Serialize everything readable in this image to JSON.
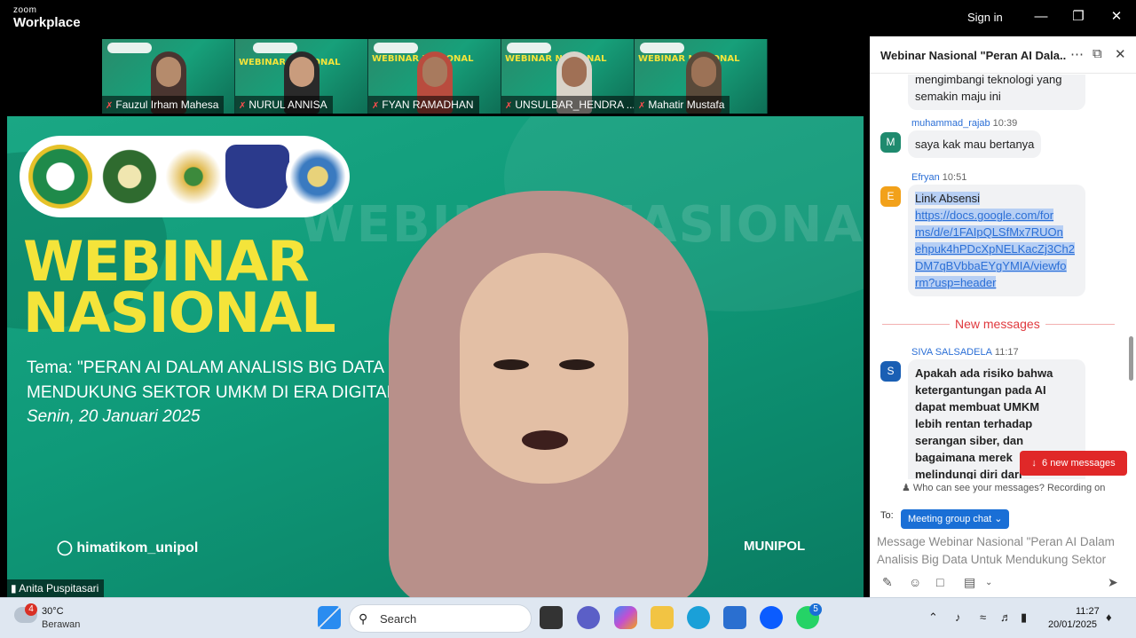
{
  "titlebar": {
    "brand_small": "zoom",
    "brand_big": "Workplace",
    "sign_in": "Sign in"
  },
  "thumbnails": [
    {
      "name": "Fauzul Irham Mahesa"
    },
    {
      "name": "NURUL ANNISA"
    },
    {
      "name": "FYAN RAMADHAN"
    },
    {
      "name": "UNSULBAR_HENDRA ..."
    },
    {
      "name": "Mahatir Mustafa"
    }
  ],
  "thumb_title": "WEBINAR NASIONAL",
  "main_video": {
    "watermark": "WEBINAR NASIONAL",
    "title_line1": "WEBINAR",
    "title_line2": "NASIONAL",
    "tema_line1": "Tema: \"PERAN AI DALAM ANALISIS BIG DATA UN",
    "tema_line2": "MENDUKUNG SEKTOR UMKM DI ERA DIGITAL\"",
    "date": "Senin, 20 Januari 2025",
    "instagram": "himatikom_unipol",
    "instagram2": "MUNIPOL",
    "speaker_name": "Anita Puspitasari"
  },
  "chat": {
    "title": "Webinar Nasional \"Peran AI Dala...",
    "messages": [
      {
        "text_line1": "mengimbangi teknologi yang",
        "text_line2": "semakin maju ini"
      },
      {
        "sender": "muhammad_rajab",
        "time": "10:39",
        "initial": "M",
        "text": "saya kak mau bertanya"
      },
      {
        "sender": "Efryan",
        "time": "10:51",
        "initial": "E",
        "text": "Link Absensi",
        "link_lines": [
          "https://docs.google.com/for",
          "ms/d/e/1FAIpQLSfMx7RUOn",
          "ehpuk4hPDcXpNELKacZj3Ch2",
          "DM7qBVbbaEYgYMIA/viewfo",
          "rm?usp=header"
        ]
      },
      {
        "sender": "SIVA SALSADELA",
        "time": "11:17",
        "initial": "S",
        "text_lines": [
          "Apakah ada risiko bahwa",
          "ketergantungan pada AI",
          "dapat membuat UMKM",
          "lebih rentan terhadap",
          "serangan siber, dan",
          "bagaimana merek",
          "melindungi diri dari"
        ]
      }
    ],
    "new_messages_label": "New messages",
    "new_messages_button": "6 new messages",
    "privacy": "Who can see your messages? Recording on",
    "to_label": "To:",
    "to_value": "Meeting group chat",
    "compose_line1": "Message Webinar Nasional \"Peran AI Dalam",
    "compose_line2": "Analisis Big Data Untuk Mendukung Sektor"
  },
  "taskbar": {
    "weather_badge": "4",
    "temperature": "30°C",
    "condition": "Berawan",
    "search_label": "Search",
    "whatsapp_badge": "5",
    "time": "11:27",
    "date": "20/01/2025"
  },
  "colors": {
    "accent": "#1a6fd6",
    "alert": "#e02828",
    "banner_green": "#17a07a",
    "banner_yellow": "#f4e43a"
  }
}
